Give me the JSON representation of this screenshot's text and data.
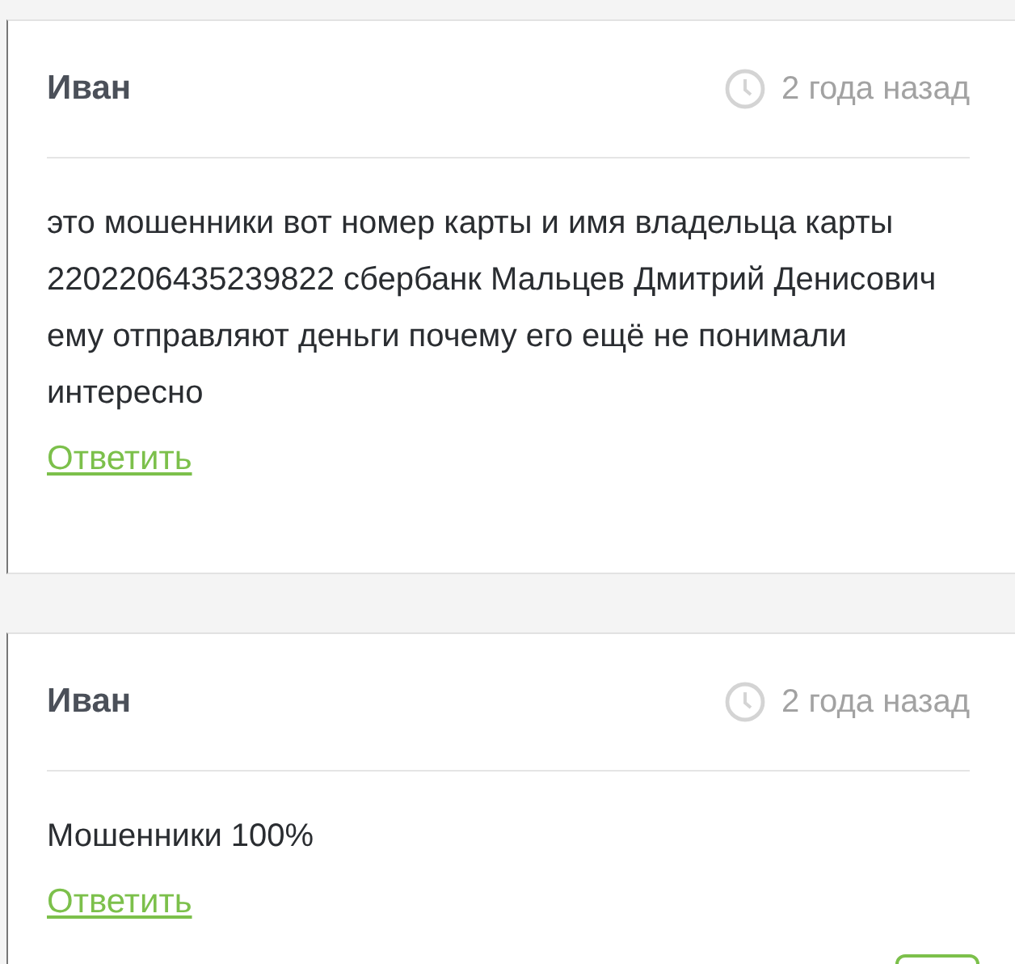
{
  "comments": [
    {
      "author": "Иван",
      "time": "2 года назад",
      "text": "это мошенники вот номер карты и имя владельца карты 2202206435239822 сбербанк Мальцев Дмитрий Денисович ему отправляют деньги почему его ещё не понимали интересно",
      "reply": "Ответить"
    },
    {
      "author": "Иван",
      "time": "2 года назад",
      "text": "Мошенники 100%",
      "reply": "Ответить"
    }
  ]
}
